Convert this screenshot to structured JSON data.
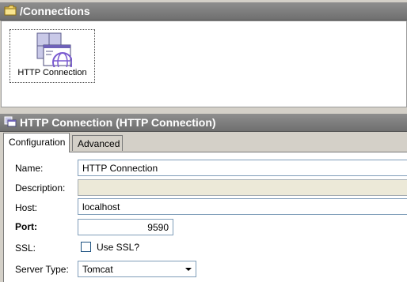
{
  "browser": {
    "title": "/Connections",
    "items": [
      {
        "label": "HTTP Connection",
        "icon": "http-connection-icon"
      }
    ]
  },
  "editor": {
    "title": "HTTP Connection (HTTP Connection)",
    "tabs": [
      {
        "label": "Configuration",
        "active": true
      },
      {
        "label": "Advanced",
        "active": false
      }
    ]
  },
  "form": {
    "name_label": "Name:",
    "name_value": "HTTP Connection",
    "description_label": "Description:",
    "description_value": "",
    "host_label": "Host:",
    "host_value": "localhost",
    "port_label": "Port:",
    "port_value": "9590",
    "ssl_label": "SSL:",
    "ssl_checkbox_label": "Use SSL?",
    "ssl_checked": false,
    "server_type_label": "Server Type:",
    "server_type_value": "Tomcat"
  },
  "colors": {
    "titlebar": "#7a7a7a",
    "panel": "#d4d0c8"
  }
}
